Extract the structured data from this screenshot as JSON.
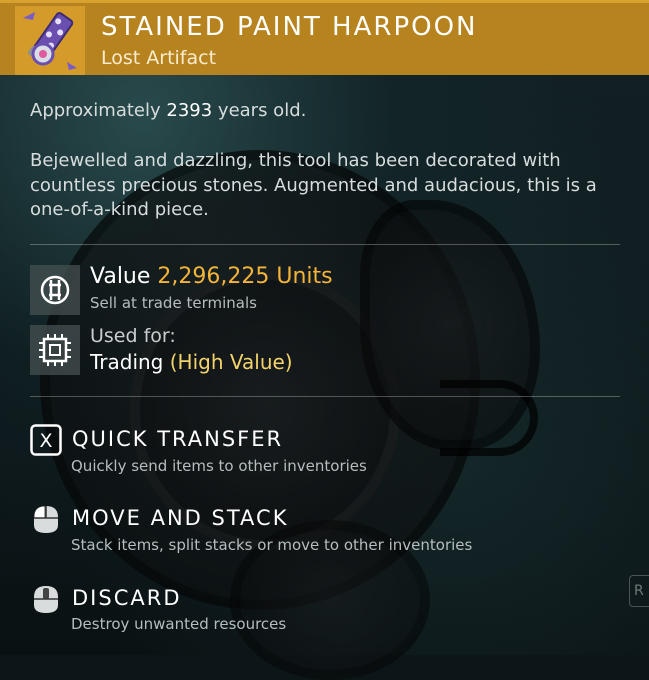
{
  "item": {
    "name": "STAINED PAINT HARPOON",
    "category": "Lost Artifact",
    "icon": "harpoon-artifact-icon",
    "header_color": "#b7831f"
  },
  "age": {
    "prefix": "Approximately",
    "years": "2393",
    "suffix": "years old."
  },
  "description": "Bejewelled and dazzling, this tool has been decorated with countless precious stones. Augmented and audacious, this is a one-of-a-kind piece.",
  "value": {
    "label": "Value",
    "amount": "2,296,225 Units",
    "subtext": "Sell at trade terminals",
    "icon": "units-currency-icon",
    "amount_color": "#f4b43a"
  },
  "usage": {
    "label": "Used for:",
    "category": "Trading",
    "qualifier": "(High Value)",
    "icon": "trade-chip-icon",
    "qualifier_color": "#f3d36b"
  },
  "actions": [
    {
      "title": "QUICK TRANSFER",
      "description": "Quickly send items to other inventories",
      "icon": "x-key-icon",
      "key": "X"
    },
    {
      "title": "MOVE AND STACK",
      "description": "Stack items, split stacks or move to other inventories",
      "icon": "mouse-left-button-icon"
    },
    {
      "title": "DISCARD",
      "description": "Destroy unwanted resources",
      "icon": "mouse-middle-button-icon"
    }
  ]
}
